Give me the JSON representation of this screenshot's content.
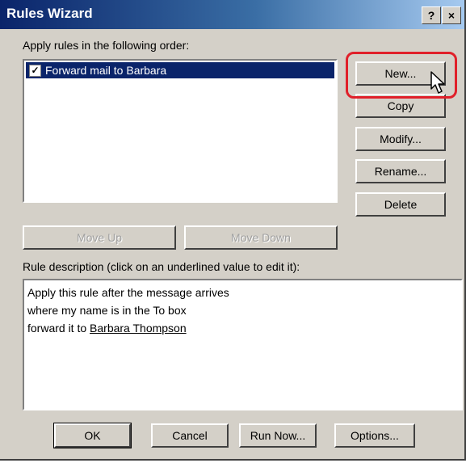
{
  "window": {
    "title": "Rules Wizard",
    "help_label": "?",
    "close_label": "×"
  },
  "rules": {
    "heading": "Apply rules in the following order:",
    "items": [
      {
        "label": "Forward mail to Barbara",
        "checked": true,
        "check_glyph": "✓"
      }
    ]
  },
  "side_buttons": {
    "new": "New...",
    "copy": "Copy",
    "modify": "Modify...",
    "rename": "Rename...",
    "delete": "Delete"
  },
  "order_buttons": {
    "move_up": "Move Up",
    "move_down": "Move Down"
  },
  "description": {
    "heading": "Rule description (click on an underlined value to edit it):",
    "line1": "Apply this rule after the message arrives",
    "line2": "where my name is in the To box",
    "line3_prefix": "forward it to ",
    "line3_link": "Barbara Thompson"
  },
  "bottom_buttons": {
    "ok": "OK",
    "cancel": "Cancel",
    "run_now": "Run Now...",
    "options": "Options..."
  },
  "colors": {
    "highlight": "#e0202a",
    "selection": "#0a246a",
    "dialog": "#d4d0c8"
  },
  "icons": {
    "cursor": "arrow-cursor-icon"
  }
}
